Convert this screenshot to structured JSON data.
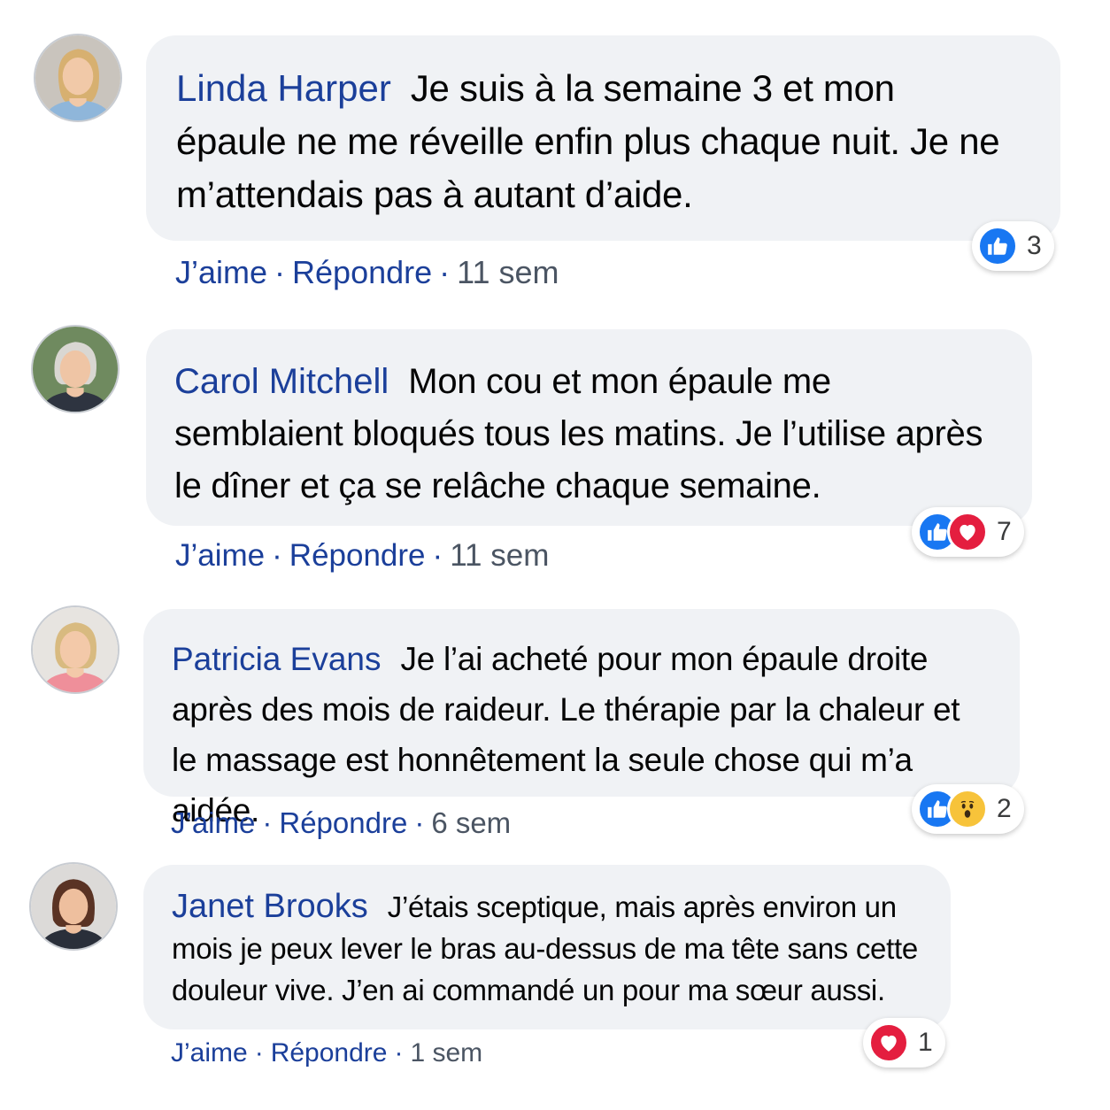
{
  "colors": {
    "link": "#1b3f9a",
    "bubble": "#f0f2f5",
    "like": "#1877f2",
    "love": "#e41e3f",
    "wow": "#f7c33a"
  },
  "comments": [
    {
      "author": "Linda Harper",
      "text": "Je suis à la semaine 3 et mon épaule ne me réveille enfin plus chaque nuit. Je ne m’attendais pas à autant d’aide.",
      "like_label": "J’aime",
      "reply_label": "Répondre",
      "time": "11 sem",
      "reactions": [
        "like-icon"
      ],
      "reaction_count": "3"
    },
    {
      "author": "Carol Mitchell",
      "text": "Mon cou et mon épaule me semblaient bloqués tous les matins. Je l’utilise après le dîner et ça se relâche chaque semaine.",
      "like_label": "J’aime",
      "reply_label": "Répondre",
      "time": "11 sem",
      "reactions": [
        "like-icon",
        "heart-icon"
      ],
      "reaction_count": "7"
    },
    {
      "author": "Patricia Evans",
      "text": "Je l’ai acheté pour mon épaule droite après des mois de raideur. Le thérapie par la chaleur et le massage est honnêtement la seule chose qui m’a aidée.",
      "like_label": "J’aime",
      "reply_label": "Répondre",
      "time": "6 sem",
      "reactions": [
        "like-icon",
        "wow-icon"
      ],
      "reaction_count": "2"
    },
    {
      "author": "Janet Brooks",
      "text": "J’étais sceptique, mais après environ un mois je peux lever le bras au-dessus de ma tête sans cette douleur vive. J’en ai commandé un pour ma sœur aussi.",
      "like_label": "J’aime",
      "reply_label": "Répondre",
      "time": "1 sem",
      "reactions": [
        "heart-icon"
      ],
      "reaction_count": "1"
    }
  ]
}
